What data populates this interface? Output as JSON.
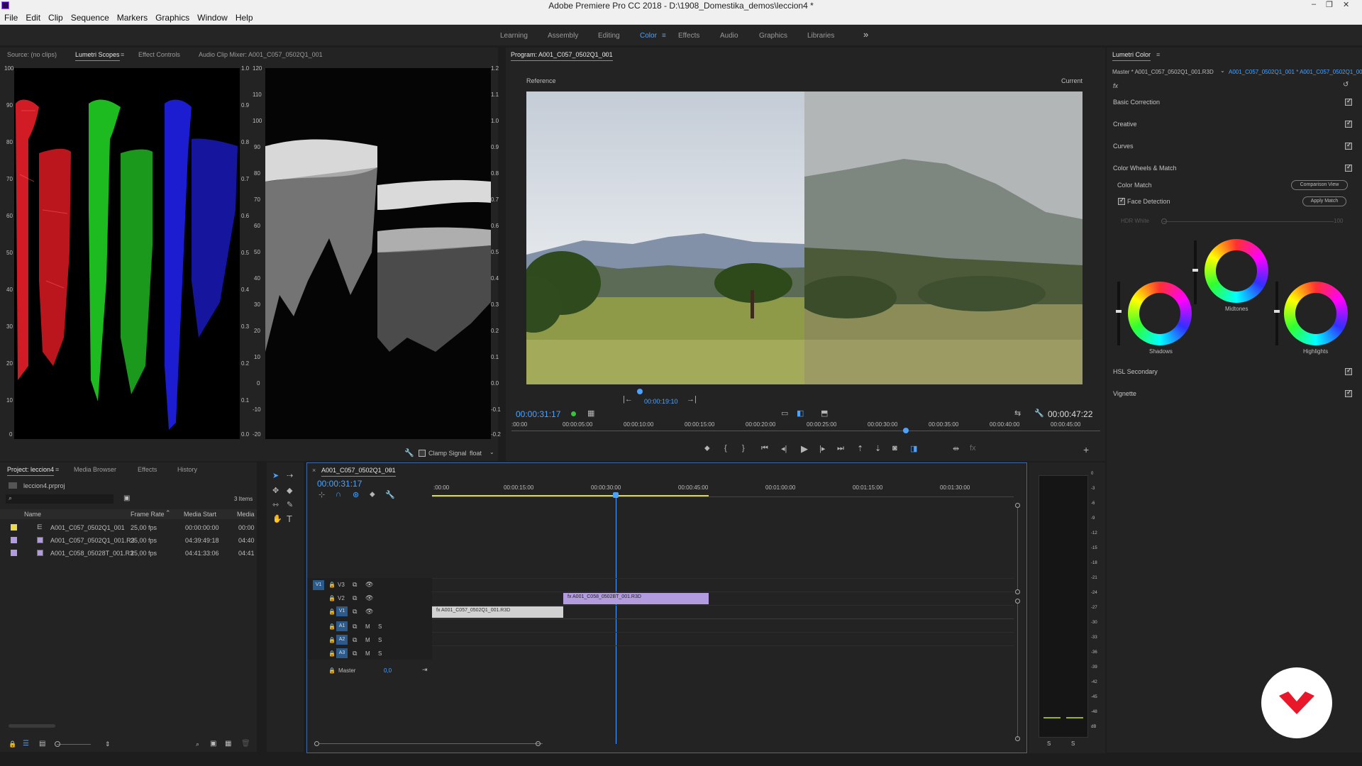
{
  "window": {
    "title": "Adobe Premiere Pro CC 2018 - D:\\1908_Domestika_demos\\leccion4 *",
    "controls": [
      "–",
      "❐",
      "✕"
    ]
  },
  "menu": [
    "File",
    "Edit",
    "Clip",
    "Sequence",
    "Markers",
    "Graphics",
    "Window",
    "Help"
  ],
  "workspaces": {
    "tabs": [
      "Learning",
      "Assembly",
      "Editing",
      "Color",
      "Effects",
      "Audio",
      "Graphics",
      "Libraries"
    ],
    "active": "Color",
    "more": "»"
  },
  "source_panel": {
    "tabs": [
      "Source: (no clips)",
      "Lumetri Scopes",
      "Effect Controls",
      "Audio Clip Mixer: A001_C057_0502Q1_001"
    ],
    "active": "Lumetri Scopes",
    "parade_left_ticks": [
      "100",
      "90",
      "80",
      "70",
      "60",
      "50",
      "40",
      "30",
      "20",
      "10",
      "0"
    ],
    "parade_right_ticks": [
      "1.0",
      "0.9",
      "0.8",
      "0.7",
      "0.6",
      "0.5",
      "0.4",
      "0.3",
      "0.2",
      "0.1",
      "0.0"
    ],
    "wave_left_ticks": [
      "120",
      "110",
      "100",
      "90",
      "80",
      "70",
      "60",
      "50",
      "40",
      "30",
      "20",
      "10",
      "0",
      "-10",
      "-20"
    ],
    "wave_right_ticks": [
      "1.2",
      "1.1",
      "1.0",
      "0.9",
      "0.8",
      "0.7",
      "0.6",
      "0.5",
      "0.4",
      "0.3",
      "0.2",
      "0.1",
      "0.0",
      "-0.1",
      "-0.2"
    ],
    "clamp_label": "Clamp Signal",
    "float_label": "float"
  },
  "program": {
    "title": "Program: A001_C057_0502Q1_001",
    "reference": "Reference",
    "current": "Current",
    "ref_timecode": "00:00:19:10",
    "timecode": "00:00:31:17",
    "duration": "00:00:47:22",
    "ruler": [
      ":00:00",
      "00:00:05:00",
      "00:00:10:00",
      "00:00:15:00",
      "00:00:20:00",
      "00:00:25:00",
      "00:00:30:00",
      "00:00:35:00",
      "00:00:40:00",
      "00:00:45:00"
    ]
  },
  "lumetri": {
    "title": "Lumetri Color",
    "master": "Master * A001_C057_0502Q1_001.R3D",
    "clip": "A001_C057_0502Q1_001 * A001_C057_0502Q1_001.R3D",
    "fx": "fx",
    "sections": [
      "Basic Correction",
      "Creative",
      "Curves",
      "Color Wheels & Match"
    ],
    "color_match": "Color Match",
    "comparison_view": "Comparison View",
    "face_detection": "Face Detection",
    "apply_match": "Apply Match",
    "hdr_white": "HDR White",
    "hdr_value": "100",
    "wheels": [
      "Shadows",
      "Midtones",
      "Highlights"
    ],
    "sections_bottom": [
      "HSL Secondary",
      "Vignette"
    ]
  },
  "project": {
    "tabs": [
      "Project: leccion4",
      "Media Browser",
      "Effects",
      "History"
    ],
    "active": "Project: leccion4",
    "file": "leccion4.prproj",
    "items_count": "3 Items",
    "columns": [
      "Name",
      "Frame Rate",
      "Media Start",
      "Media"
    ],
    "rows": [
      {
        "name": "A001_C057_0502Q1_001",
        "fps": "25,00 fps",
        "start": "00:00:00:00",
        "media": "00:00",
        "color": "#e8d84a"
      },
      {
        "name": "A001_C057_0502Q1_001.R3",
        "fps": "25,00 fps",
        "start": "04:39:49:18",
        "media": "04:40",
        "color": "#b39be0"
      },
      {
        "name": "A001_C058_05028T_001.R3",
        "fps": "25,00 fps",
        "start": "04:41:33:06",
        "media": "04:41",
        "color": "#b39be0"
      }
    ]
  },
  "timeline": {
    "tab": "A001_C057_0502Q1_001",
    "timecode": "00:00:31:17",
    "ruler": [
      ":00:00",
      "00:00:15:00",
      "00:00:30:00",
      "00:00:45:00",
      "00:01:00:00",
      "00:01:15:00",
      "00:01:30:00"
    ],
    "tracks": [
      {
        "id": "V3",
        "src": "V1"
      },
      {
        "id": "V2"
      },
      {
        "id": "V1",
        "src": "V1"
      },
      {
        "id": "A1",
        "src": "A1"
      },
      {
        "id": "A2",
        "src": "A2"
      },
      {
        "id": "A3",
        "src": "A3"
      }
    ],
    "master": "Master",
    "master_value": "0,0",
    "clips": [
      {
        "name": "A001_C058_0502BT_001.R3D",
        "track": "V2"
      },
      {
        "name": "A001_C057_0502Q1_001.R3D",
        "track": "V1"
      }
    ]
  },
  "meter": {
    "ticks": [
      "0",
      "-3",
      "-6",
      "-9",
      "-12",
      "-15",
      "-18",
      "-21",
      "-24",
      "-27",
      "-30",
      "-33",
      "-36",
      "-39",
      "-42",
      "-45",
      "-48",
      "dB"
    ],
    "solo": [
      "S",
      "S"
    ]
  }
}
